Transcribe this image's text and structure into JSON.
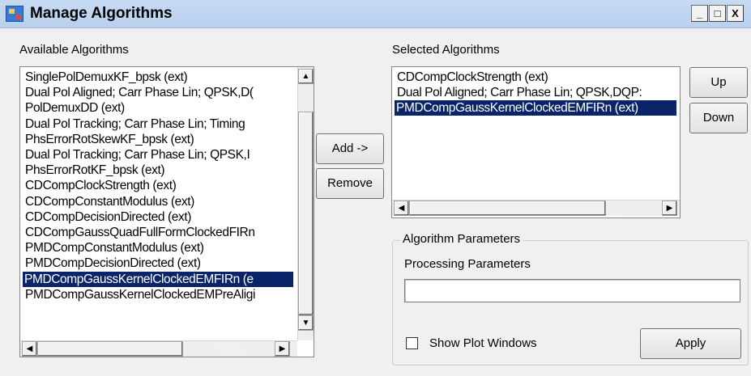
{
  "window": {
    "title": "Manage Algorithms",
    "controls": {
      "minimize": "_",
      "maximize": "□",
      "close": "X"
    }
  },
  "available": {
    "label": "Available Algorithms",
    "items": [
      "SinglePolDemuxKF_bpsk (ext)",
      "Dual Pol Aligned; Carr Phase Lin; QPSK,D(",
      "PolDemuxDD (ext)",
      "Dual Pol Tracking; Carr Phase Lin; Timing",
      "PhsErrorRotSkewKF_bpsk (ext)",
      "Dual Pol Tracking; Carr Phase Lin; QPSK,I",
      "PhsErrorRotKF_bpsk (ext)",
      "CDCompClockStrength (ext)",
      "CDCompConstantModulus (ext)",
      "CDCompDecisionDirected (ext)",
      "CDCompGaussQuadFullFormClockedFIRn",
      "PMDCompConstantModulus (ext)",
      "PMDCompDecisionDirected (ext)",
      "PMDCompGaussKernelClockedEMFIRn (e",
      "PMDCompGaussKernelClockedEMPreAligi"
    ],
    "selected_index": 13
  },
  "selected": {
    "label": "Selected Algorithms",
    "items": [
      "CDCompClockStrength (ext)",
      "Dual Pol Aligned; Carr Phase Lin; QPSK,DQP:",
      "PMDCompGaussKernelClockedEMFIRn (ext)"
    ],
    "selected_index": 2
  },
  "buttons": {
    "add": "Add ->",
    "remove": "Remove",
    "up": "Up",
    "down": "Down",
    "apply": "Apply"
  },
  "parameters": {
    "group_title": "Algorithm Parameters",
    "processing_label": "Processing Parameters",
    "processing_value": "",
    "show_plot_label": "Show Plot Windows",
    "show_plot_checked": false
  },
  "scroll": {
    "up_arrow": "▲",
    "down_arrow": "▼",
    "left_arrow": "◀",
    "right_arrow": "▶"
  }
}
